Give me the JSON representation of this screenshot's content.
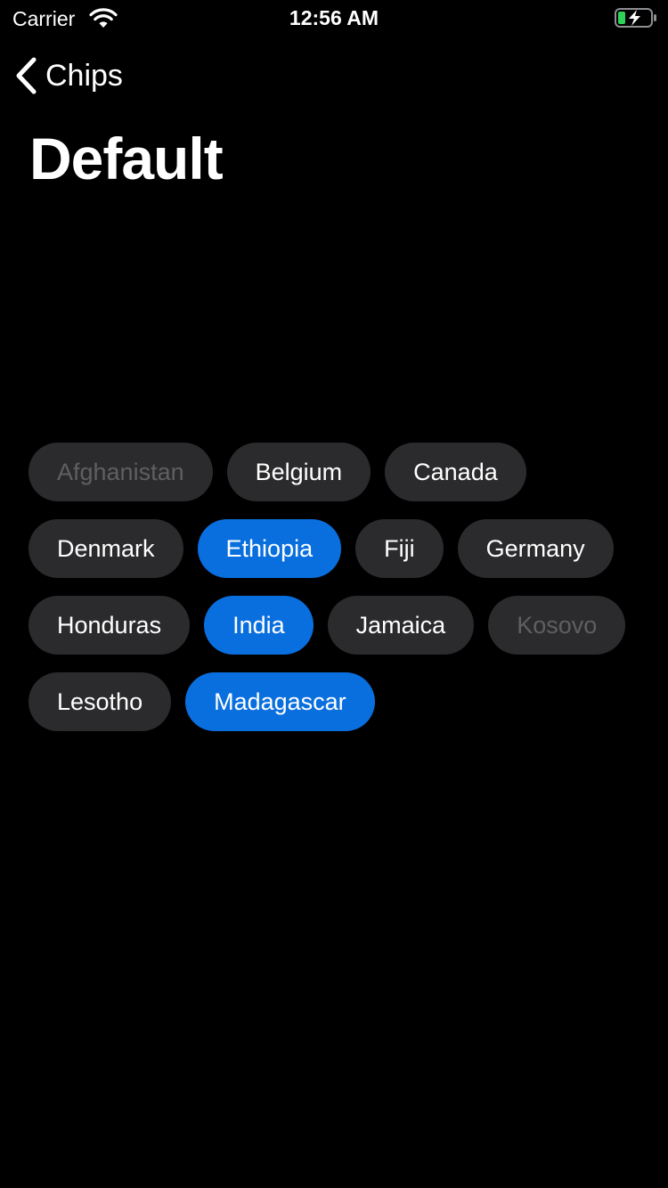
{
  "status_bar": {
    "carrier": "Carrier",
    "time": "12:56 AM",
    "wifi_icon": "wifi-icon",
    "battery_icon": "battery-charging-icon",
    "battery_color": "#30d158"
  },
  "nav": {
    "back_label": "Chips",
    "back_icon": "chevron-left-icon"
  },
  "page": {
    "title": "Default"
  },
  "chips": [
    {
      "label": "Afghanistan",
      "state": "disabled"
    },
    {
      "label": "Belgium",
      "state": "normal"
    },
    {
      "label": "Canada",
      "state": "normal"
    },
    {
      "label": "Denmark",
      "state": "normal"
    },
    {
      "label": "Ethiopia",
      "state": "selected"
    },
    {
      "label": "Fiji",
      "state": "normal"
    },
    {
      "label": "Germany",
      "state": "normal"
    },
    {
      "label": "Honduras",
      "state": "normal"
    },
    {
      "label": "India",
      "state": "selected"
    },
    {
      "label": "Jamaica",
      "state": "normal"
    },
    {
      "label": "Kosovo",
      "state": "disabled"
    },
    {
      "label": "Lesotho",
      "state": "normal"
    },
    {
      "label": "Madagascar",
      "state": "selected"
    }
  ],
  "colors": {
    "background": "#000000",
    "chip_default": "#2b2b2d",
    "chip_selected": "#0a6fde",
    "chip_disabled_text": "#5f5f62"
  }
}
